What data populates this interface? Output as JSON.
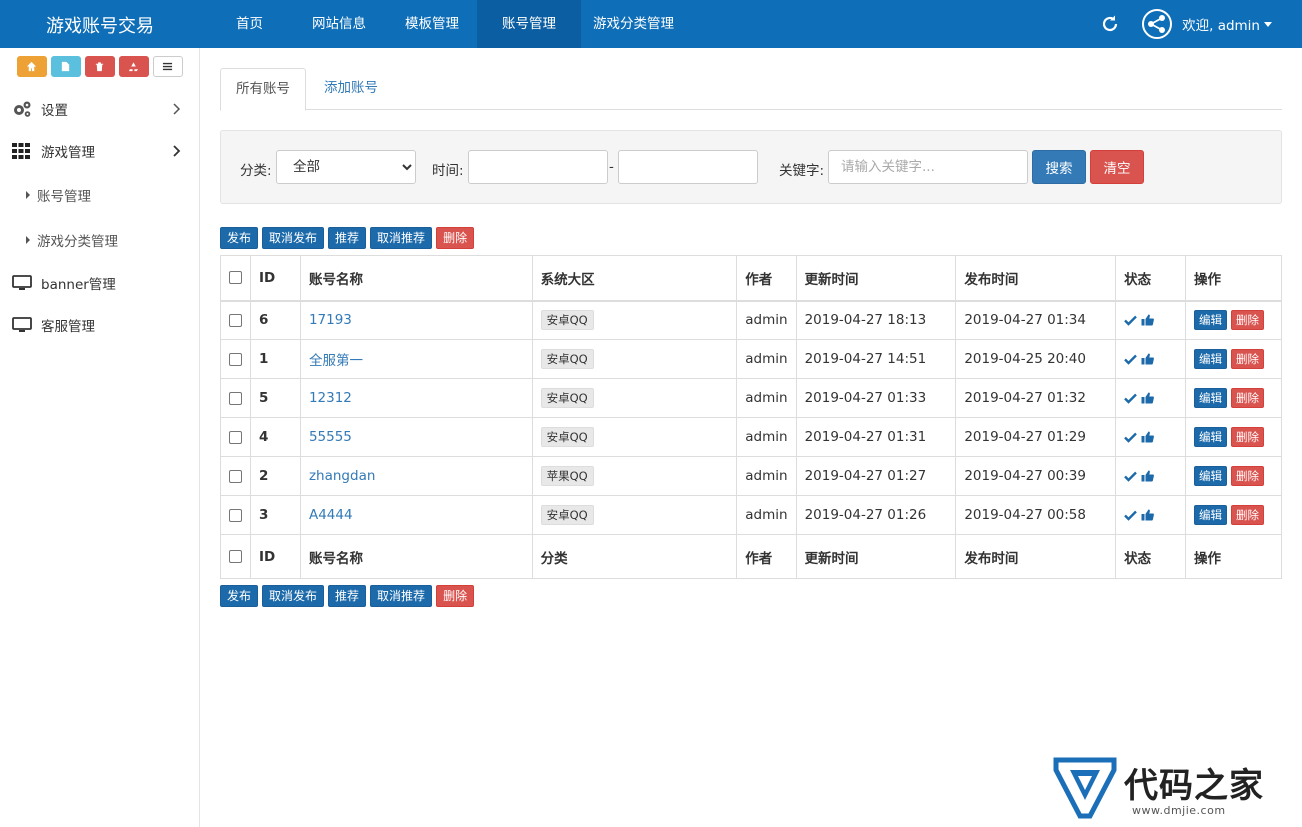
{
  "app": {
    "title": "游戏账号交易",
    "nav": [
      "首页",
      "网站信息",
      "模板管理",
      "账号管理",
      "游戏分类管理"
    ],
    "nav_active": 3,
    "user": "欢迎, admin"
  },
  "sidebar": {
    "quick_buttons": [
      "home-icon",
      "file-icon",
      "trash-icon",
      "recycle-icon",
      "list-icon"
    ],
    "items": [
      {
        "label": "设置",
        "icon": "gear-icon"
      },
      {
        "label": "游戏管理",
        "icon": "grid-icon"
      },
      {
        "label": "账号管理",
        "sub": true
      },
      {
        "label": "游戏分类管理",
        "sub": true
      },
      {
        "label": "banner管理",
        "icon": "monitor-icon"
      },
      {
        "label": "客服管理",
        "icon": "monitor-icon"
      }
    ]
  },
  "tabs": [
    "所有账号",
    "添加账号"
  ],
  "filter": {
    "category_label": "分类:",
    "category_value": "全部",
    "time_label": "时间:",
    "time_sep": "-",
    "keyword_label": "关键字:",
    "keyword_placeholder": "请输入关键字...",
    "search": "搜索",
    "clear": "清空"
  },
  "actions": [
    "发布",
    "取消发布",
    "推荐",
    "取消推荐",
    "删除"
  ],
  "table": {
    "headers": [
      "ID",
      "账号名称",
      "系统大区",
      "作者",
      "更新时间",
      "发布时间",
      "状态",
      "操作"
    ],
    "footers": [
      "ID",
      "账号名称",
      "分类",
      "作者",
      "更新时间",
      "发布时间",
      "状态",
      "操作"
    ],
    "rows": [
      {
        "id": "6",
        "name": "17193",
        "zone": "安卓QQ",
        "author": "admin",
        "updated": "2019-04-27 18:13",
        "published": "2019-04-27 01:34"
      },
      {
        "id": "1",
        "name": "全服第一",
        "zone": "安卓QQ",
        "author": "admin",
        "updated": "2019-04-27 14:51",
        "published": "2019-04-25 20:40"
      },
      {
        "id": "5",
        "name": "12312",
        "zone": "安卓QQ",
        "author": "admin",
        "updated": "2019-04-27 01:33",
        "published": "2019-04-27 01:32"
      },
      {
        "id": "4",
        "name": "55555",
        "zone": "安卓QQ",
        "author": "admin",
        "updated": "2019-04-27 01:31",
        "published": "2019-04-27 01:29"
      },
      {
        "id": "2",
        "name": "zhangdan",
        "zone": "苹果QQ",
        "author": "admin",
        "updated": "2019-04-27 01:27",
        "published": "2019-04-27 00:39"
      },
      {
        "id": "3",
        "name": "A4444",
        "zone": "安卓QQ",
        "author": "admin",
        "updated": "2019-04-27 01:26",
        "published": "2019-04-27 00:58"
      }
    ],
    "edit": "编辑",
    "delete": "删除"
  },
  "watermark": {
    "text": "代码之家",
    "url": "www.dmjie.com"
  },
  "colors": {
    "primary": "#0e6eb8",
    "danger": "#d9534f",
    "link": "#337ab7"
  }
}
